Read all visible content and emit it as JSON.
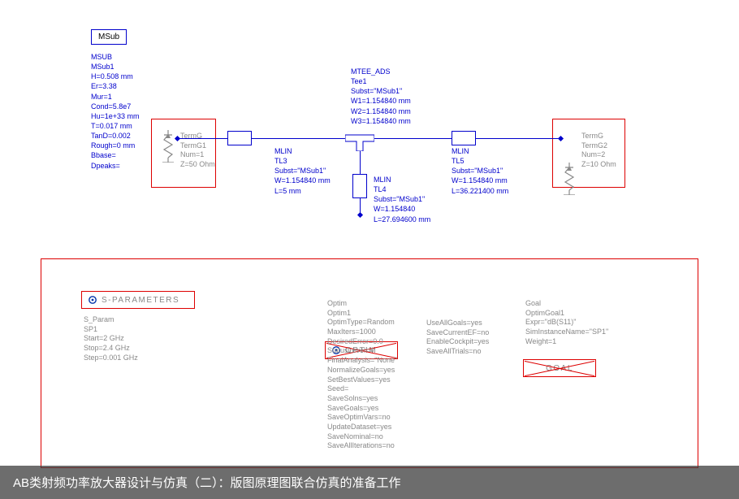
{
  "msub": {
    "box_label": "MSub",
    "lines": [
      "MSUB",
      "MSub1",
      "H=0.508 mm",
      "Er=3.38",
      "Mur=1",
      "Cond=5.8e7",
      "Hu=1e+33 mm",
      "T=0.017 mm",
      "TanD=0.002",
      "Rough=0 mm",
      "Bbase=",
      "Dpeaks="
    ]
  },
  "termG1": {
    "lines": [
      "TermG",
      "TermG1",
      "Num=1",
      "Z=50 Ohm"
    ]
  },
  "termG2": {
    "lines": [
      "TermG",
      "TermG2",
      "Num=2",
      "Z=10 Ohm"
    ]
  },
  "mlin_tl3": {
    "title": "MLIN",
    "lines": [
      "TL3",
      "Subst=\"MSub1\"",
      "W=1.154840 mm",
      "L=5 mm"
    ]
  },
  "mlin_tl4": {
    "title": "MLIN",
    "lines": [
      "TL4",
      "Subst=\"MSub1\"",
      "W=1.154840",
      "L=27.694600 mm"
    ]
  },
  "mlin_tl5": {
    "title": "MLIN",
    "lines": [
      "TL5",
      "Subst=\"MSub1\"",
      "W=1.154840 mm",
      "L=36.221400 mm"
    ]
  },
  "mtee": {
    "title": "MTEE_ADS",
    "lines": [
      "Tee1",
      "Subst=\"MSub1\"",
      "W1=1.154840 mm",
      "W2=1.154840 mm",
      "W3=1.154840 mm"
    ]
  },
  "sparam": {
    "label": "S-PARAMETERS",
    "lines": [
      "S_Param",
      "SP1",
      "Start=2 GHz",
      "Stop=2.4 GHz",
      "Step=0.001 GHz"
    ]
  },
  "optim": {
    "label": "OPTIM",
    "col1": [
      "Optim",
      "Optim1",
      "OptimType=Random",
      "MaxIters=1000",
      "DesiredError=0.0",
      "StatusLevel=4",
      "FinalAnalysis=\"None\"",
      "NormalizeGoals=yes",
      "SetBestValues=yes",
      "Seed=",
      "SaveSolns=yes",
      "SaveGoals=yes",
      "SaveOptimVars=no",
      "UpdateDataset=yes",
      "SaveNominal=no",
      "SaveAllIterations=no"
    ],
    "col2": [
      "UseAllGoals=yes",
      "SaveCurrentEF=no",
      "EnableCockpit=yes",
      "SaveAllTrials=no"
    ]
  },
  "goal": {
    "label": "GOAL",
    "lines": [
      "Goal",
      "OptimGoal1",
      "Expr=\"dB(S11)\"",
      "SimInstanceName=\"SP1\"",
      "Weight=1"
    ]
  },
  "caption": "AB类射频功率放大器设计与仿真（二）：版图原理图联合仿真的准备工作"
}
